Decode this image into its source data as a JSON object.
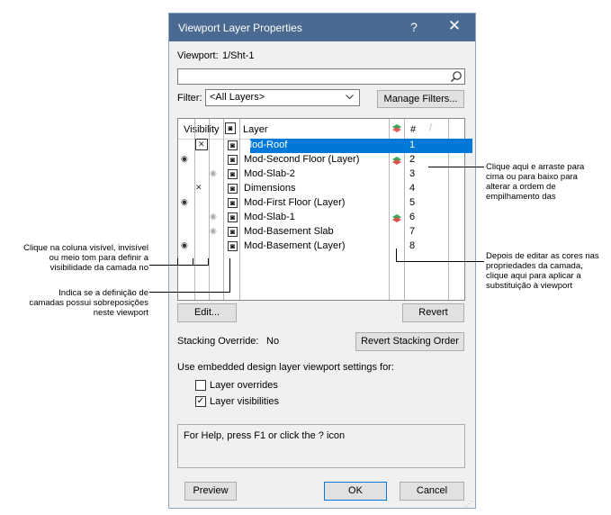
{
  "dialog": {
    "title": "Viewport Layer Properties",
    "help_glyph": "?",
    "close_glyph": "✕",
    "viewport_label": "Viewport:",
    "viewport_value": "1/Sht-1",
    "search_icon": "search-icon",
    "filter_label": "Filter:",
    "filter_value": "<All Layers>",
    "manage_filters_label": "Manage Filters...",
    "columns": {
      "visibility": "Visibility",
      "layer": "Layer",
      "number": "#"
    },
    "layers": [
      {
        "visibility": "invisible-hatched",
        "name": "Mod-Roof",
        "number": "1",
        "override": false,
        "selected": true
      },
      {
        "visibility": "visible",
        "name": "Mod-Second Floor (Layer)",
        "number": "2",
        "override": true,
        "selected": false
      },
      {
        "visibility": "gray",
        "name": "Mod-Slab-2",
        "number": "3",
        "override": false,
        "selected": false
      },
      {
        "visibility": "invisible",
        "name": "Dimensions",
        "number": "4",
        "override": false,
        "selected": false
      },
      {
        "visibility": "visible",
        "name": "Mod-First Floor (Layer)",
        "number": "5",
        "override": false,
        "selected": false
      },
      {
        "visibility": "gray",
        "name": "Mod-Slab-1",
        "number": "6",
        "override": true,
        "selected": false
      },
      {
        "visibility": "gray",
        "name": "Mod-Basement Slab",
        "number": "7",
        "override": false,
        "selected": false
      },
      {
        "visibility": "visible",
        "name": "Mod-Basement (Layer)",
        "number": "8",
        "override": false,
        "selected": false
      }
    ],
    "edit_label": "Edit...",
    "revert_label": "Revert",
    "stacking_override_label": "Stacking Override:",
    "stacking_override_value": "No",
    "revert_stacking_label": "Revert Stacking Order",
    "embedded_label": "Use embedded design layer viewport settings for:",
    "layer_overrides_label": "Layer overrides",
    "layer_overrides_checked": false,
    "layer_visibilities_label": "Layer visibilities",
    "layer_visibilities_checked": true,
    "help_text": "For Help, press F1 or click the ? icon",
    "preview_label": "Preview",
    "ok_label": "OK",
    "cancel_label": "Cancel"
  },
  "annotations": {
    "stacking_note": [
      "Clique aqui e arraste para",
      "cima ou para baixo para",
      "alterar a ordem de",
      "empilhamento das"
    ],
    "override_color_note": [
      "Depois de editar as cores nas",
      "propriedades da camada,",
      "clique aqui para aplicar a",
      "substituição à viewport"
    ],
    "visibility_note": [
      "Clique na coluna visível, invisível",
      "ou meio tom para definir a",
      "visibilidade da camada no"
    ],
    "override_indicator_note": [
      "Indica se a definição de",
      "camadas possui sobreposições",
      "neste viewport"
    ]
  },
  "colors": {
    "titlebar": "#4a6a92",
    "selection": "#0078d7",
    "stack_icon": "#3aa655"
  }
}
